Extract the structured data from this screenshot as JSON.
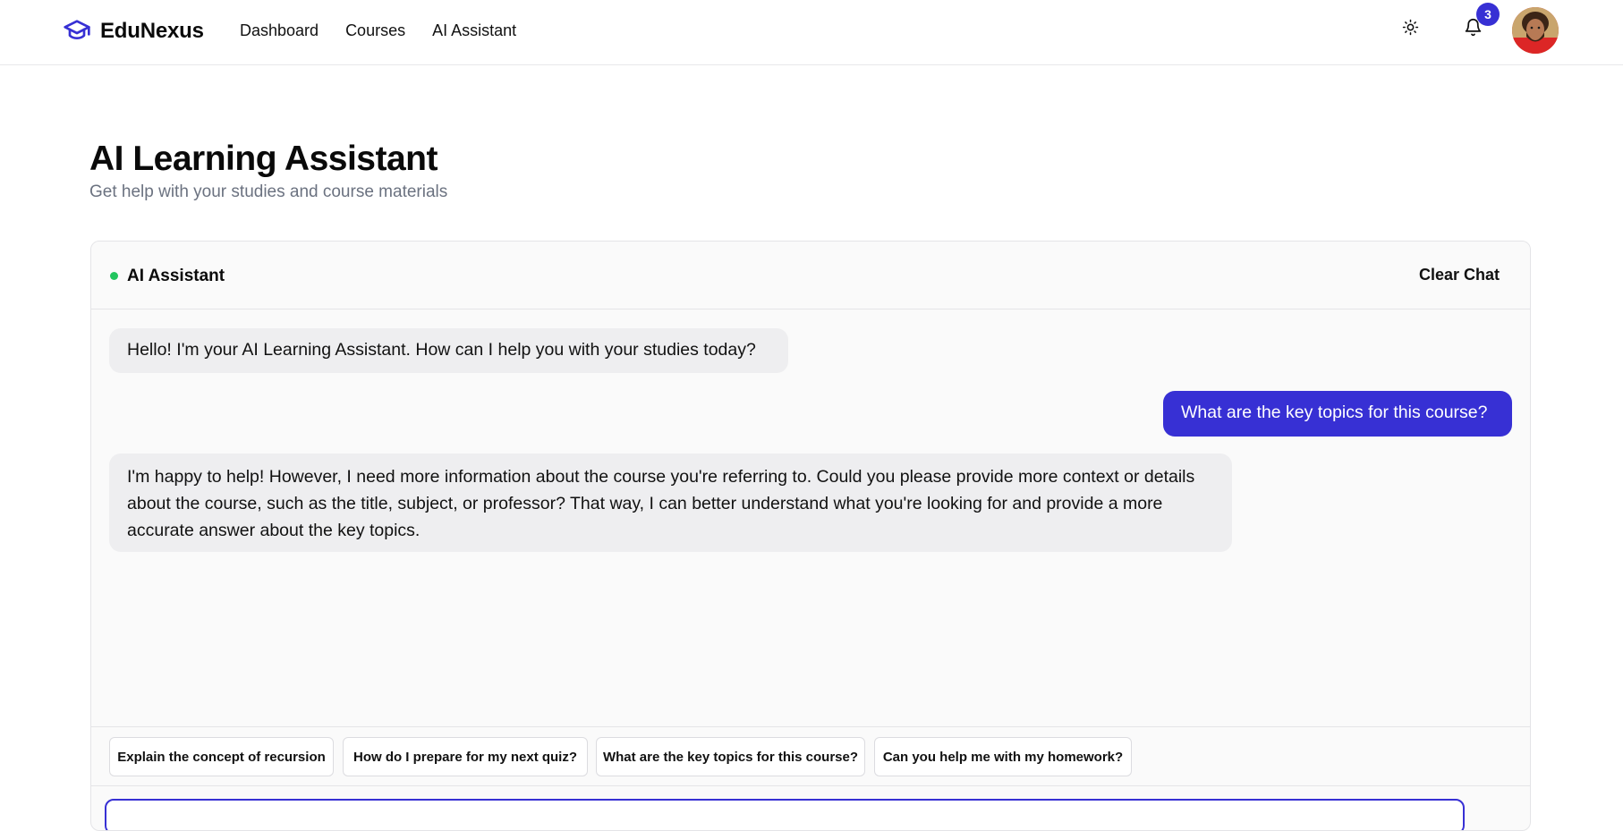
{
  "brand": {
    "name": "EduNexus",
    "accent": "#3730d4"
  },
  "nav": {
    "links": [
      "Dashboard",
      "Courses",
      "AI Assistant"
    ]
  },
  "header_actions": {
    "theme_icon": "sun-icon",
    "bell_icon": "bell-icon",
    "notification_count": "3"
  },
  "page": {
    "title": "AI Learning Assistant",
    "subtitle": "Get help with your studies and course materials"
  },
  "chat": {
    "title": "AI Assistant",
    "status_color": "#22c55e",
    "clear_label": "Clear Chat",
    "messages": [
      {
        "role": "assistant",
        "text": "Hello! I'm your AI Learning Assistant. How can I help you with your studies today?"
      },
      {
        "role": "user",
        "text": "What are the key topics for this course?"
      },
      {
        "role": "assistant",
        "text": "I'm happy to help! However, I need more information about the course you're referring to. Could you please provide more context or details about the course, such as the title, subject, or professor? That way, I can better understand what you're looking for and provide a more accurate answer about the key topics."
      }
    ],
    "suggestions": [
      "Explain the concept of recursion",
      "How do I prepare for my next quiz?",
      "What are the key topics for this course?",
      "Can you help me with my homework?"
    ],
    "input_value": ""
  }
}
